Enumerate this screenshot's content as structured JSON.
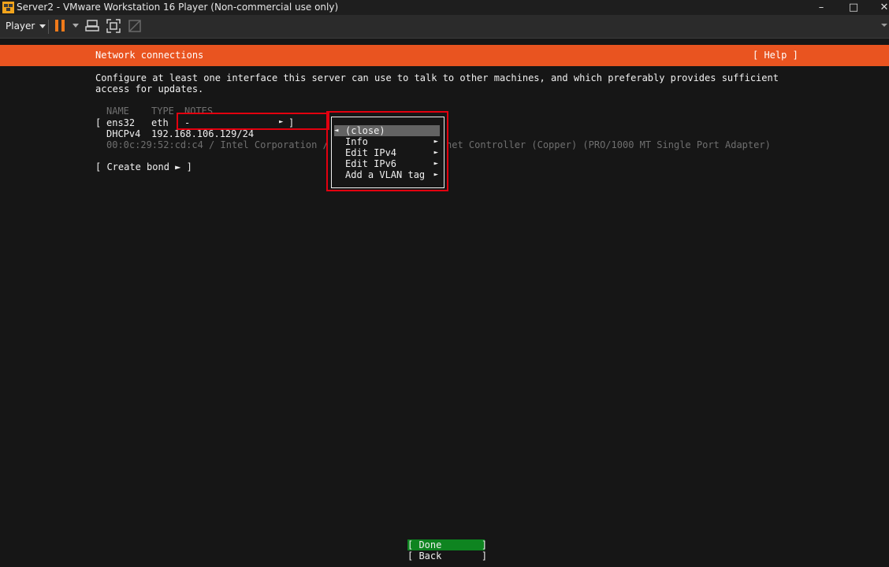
{
  "window": {
    "title": "Server2 - VMware Workstation 16 Player (Non-commercial use only)",
    "minimize": "–",
    "maximize": "□",
    "close": "✕"
  },
  "toolbar": {
    "player_label": "Player"
  },
  "screen": {
    "header_title": "Network connections",
    "help": "[ Help ]",
    "description_line1": "Configure at least one interface this server can use to talk to other machines, and which preferably provides sufficient",
    "description_line2": "access for updates.",
    "columns": {
      "name": "NAME",
      "type": "TYPE",
      "notes": "NOTES"
    },
    "interface": {
      "bracket_open": "[",
      "name": "ens32",
      "type": "eth",
      "notes": "-",
      "arrow": "►",
      "bracket_close": "]",
      "dhcp_label": "DHCPv4",
      "address": "192.168.106.129/24",
      "hw_left": "00:0c:29:52:cd:c4 / Intel Corporation /",
      "hw_right": "net Controller (Copper) (PRO/1000 MT Single Port Adapter)"
    },
    "create_bond": "[ Create bond ► ]",
    "menu": {
      "items": [
        {
          "label": "(close)",
          "left_arrow": "◄"
        },
        {
          "label": "Info",
          "arrow": "►"
        },
        {
          "label": "Edit IPv4",
          "arrow": "►"
        },
        {
          "label": "Edit IPv6",
          "arrow": "►"
        },
        {
          "label": "Add a VLAN tag",
          "arrow": "►"
        }
      ]
    },
    "buttons": {
      "done": "[ Done       ]",
      "back": "[ Back       ]"
    }
  },
  "colors": {
    "header": "#e95420",
    "done_button": "#0e8420",
    "highlight": "#e3000f",
    "pause": "#f07a1a"
  }
}
